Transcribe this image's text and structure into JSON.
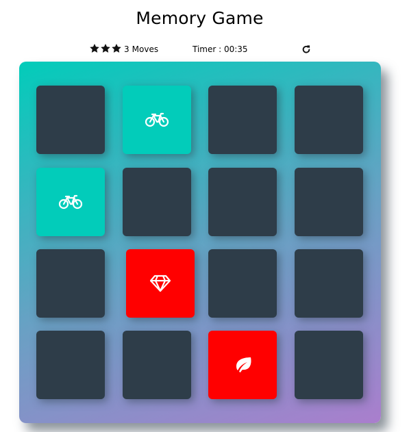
{
  "header": {
    "title": "Memory Game"
  },
  "score_panel": {
    "stars": [
      {
        "icon": "star-icon",
        "filled": true
      },
      {
        "icon": "star-icon",
        "filled": true
      },
      {
        "icon": "star-icon",
        "filled": true
      }
    ],
    "moves_count": "3",
    "moves_label": "Moves",
    "timer_text": "Timer : 00:35",
    "restart_icon": "restart-icon"
  },
  "colors": {
    "card_back": "#2e3d49",
    "card_open": "#02ccba",
    "card_unmatched": "#ff0000",
    "deck_gradient_start": "#02ccba",
    "deck_gradient_end": "#aa7ecd"
  },
  "deck": {
    "rows": 4,
    "columns": 4,
    "cards": [
      {
        "state": "closed",
        "icon": null
      },
      {
        "state": "open",
        "icon": "bicycle"
      },
      {
        "state": "closed",
        "icon": null
      },
      {
        "state": "closed",
        "icon": null
      },
      {
        "state": "open",
        "icon": "bicycle"
      },
      {
        "state": "closed",
        "icon": null
      },
      {
        "state": "closed",
        "icon": null
      },
      {
        "state": "closed",
        "icon": null
      },
      {
        "state": "closed",
        "icon": null
      },
      {
        "state": "unmatched",
        "icon": "diamond"
      },
      {
        "state": "closed",
        "icon": null
      },
      {
        "state": "closed",
        "icon": null
      },
      {
        "state": "closed",
        "icon": null
      },
      {
        "state": "closed",
        "icon": null
      },
      {
        "state": "unmatched",
        "icon": "leaf"
      },
      {
        "state": "closed",
        "icon": null
      }
    ]
  }
}
